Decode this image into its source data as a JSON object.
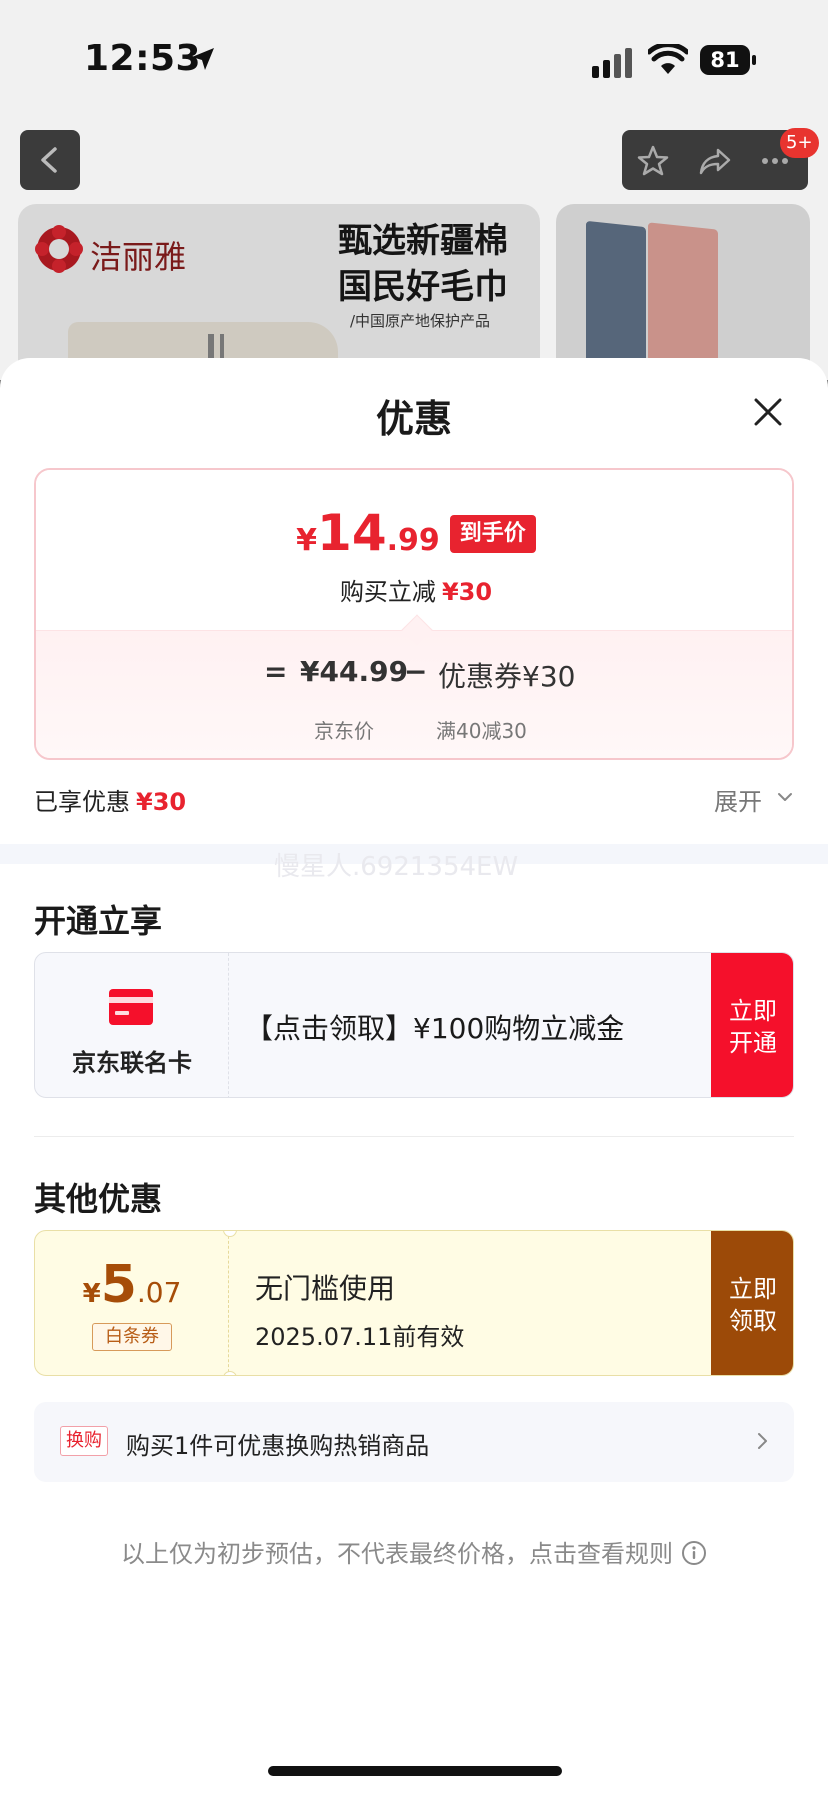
{
  "status_bar": {
    "time": "12:53",
    "battery": "81"
  },
  "top_nav": {
    "badge": "5+"
  },
  "banner": {
    "brand": "洁丽雅",
    "title_line1": "甄选新疆棉",
    "title_line2": "国民好毛巾",
    "subtitle": "/中国原产地保护产品"
  },
  "sheet": {
    "title": "优惠",
    "price": {
      "currency": "¥",
      "integer": "14",
      "decimal": ".99",
      "tag": "到手价",
      "reduce_label": "购买立减",
      "reduce_amount": "¥30",
      "equals": "=",
      "base_price": "¥44.99",
      "minus": "−",
      "coupon_label": "优惠券¥30",
      "base_price_label": "京东价",
      "coupon_condition": "满40减30"
    },
    "enjoyed": {
      "label": "已享优惠",
      "amount": "¥30",
      "expand": "展开"
    },
    "watermark": "慢星人.6921354EW",
    "open_section": {
      "title": "开通立享",
      "card_name": "京东联名卡",
      "card_text": "【点击领取】¥100购物立减金",
      "button_line1": "立即",
      "button_line2": "开通"
    },
    "other_section": {
      "title": "其他优惠",
      "coupon": {
        "currency": "¥",
        "integer": "5",
        "decimal": ".07",
        "type": "白条券",
        "title": "无门槛使用",
        "valid": "2025.07.11前有效",
        "button_line1": "立即",
        "button_line2": "领取"
      },
      "swap": {
        "tag": "换购",
        "text": "购买1件可优惠换购热销商品"
      }
    },
    "disclaimer": "以上仅为初步预估，不代表最终价格，点击查看规则"
  },
  "colors": {
    "accent_red": "#e8232f",
    "coupon_brown": "#9c4a08",
    "card_red": "#f5102b"
  },
  "icons": [
    "location-arrow-icon",
    "signal-icon",
    "wifi-icon",
    "battery-icon",
    "back-icon",
    "star-icon",
    "share-icon",
    "more-icon",
    "close-icon",
    "chevron-down-icon",
    "credit-card-icon",
    "chevron-right-icon",
    "info-icon"
  ]
}
